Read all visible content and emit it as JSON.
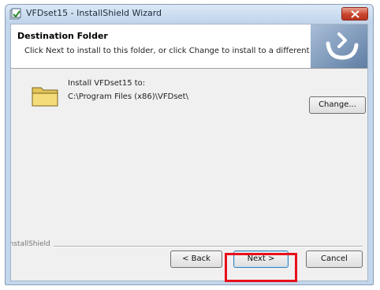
{
  "window": {
    "title": "VFDset15 - InstallShield Wizard"
  },
  "header": {
    "title": "Destination Folder",
    "subtitle": "Click Next to install to this folder, or click Change to install to a different folder."
  },
  "destination": {
    "label": "Install VFDset15 to:",
    "path": "C:\\Program Files (x86)\\VFDset\\",
    "change_label": "Change..."
  },
  "footer": {
    "brand": "InstallShield",
    "back_label": "< Back",
    "next_label": "Next >",
    "cancel_label": "Cancel"
  },
  "icons": {
    "app": "installer-app-icon",
    "close": "close-icon",
    "folder": "folder-icon",
    "banner": "installshield-logo-icon"
  },
  "colors": {
    "highlight": "#e8101a",
    "close_button": "#c8452b",
    "header_bg": "#ffffff"
  }
}
